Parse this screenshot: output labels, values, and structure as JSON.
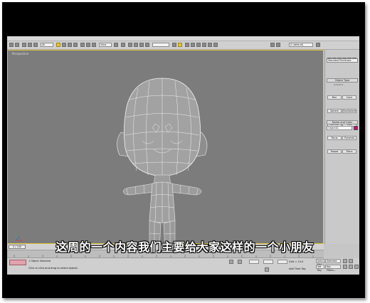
{
  "menubar": {
    "items": [
      "File",
      "Edit",
      "Tools",
      "Group",
      "Views",
      "Create",
      "Modifiers",
      "reactor",
      "Animation",
      "Graph Editors",
      "Rendering",
      "Customize",
      "MAXScript",
      "Help"
    ]
  },
  "toolbar": {
    "selection_filter": "All",
    "coord_system": "View",
    "selection_set": "",
    "layer": "0 (default)"
  },
  "viewport": {
    "label": "Perspective",
    "colors": {
      "background": "#7c7c7c",
      "active_border": "#e3c53c",
      "mesh_fill": "#9a9a9a",
      "mesh_wire": "#f2f2f2"
    }
  },
  "command_panel": {
    "dropdown": "Standard Primitives",
    "object_type_title": "Object Type",
    "autogrid_label": "AutoGrid",
    "buttons": [
      "Box",
      "Cone",
      "Sphere",
      "GeoSphere",
      "Cylinder",
      "Tube",
      "Torus",
      "Pyramid",
      "Teapot",
      "Plane"
    ],
    "name_color_title": "Name and Color",
    "name_value": "Object01",
    "swatch_color": "#b4127a"
  },
  "timeline": {
    "frame_readout": "0 / 100"
  },
  "status_bar": {
    "selection_text": "1 Object Selected",
    "prompt_text": "Click or click-and-drag to select objects",
    "grid_readout": "Grid = 10.0",
    "auto_key_label": "Auto Key",
    "selected_label": "Selected",
    "set_key_label": "Set Key",
    "key_filters_label": "Key Filters...",
    "add_time_tag_label": "Add Time Tag"
  },
  "subtitle": "这周的一个内容我们主要给大家这样的一个小朋友"
}
